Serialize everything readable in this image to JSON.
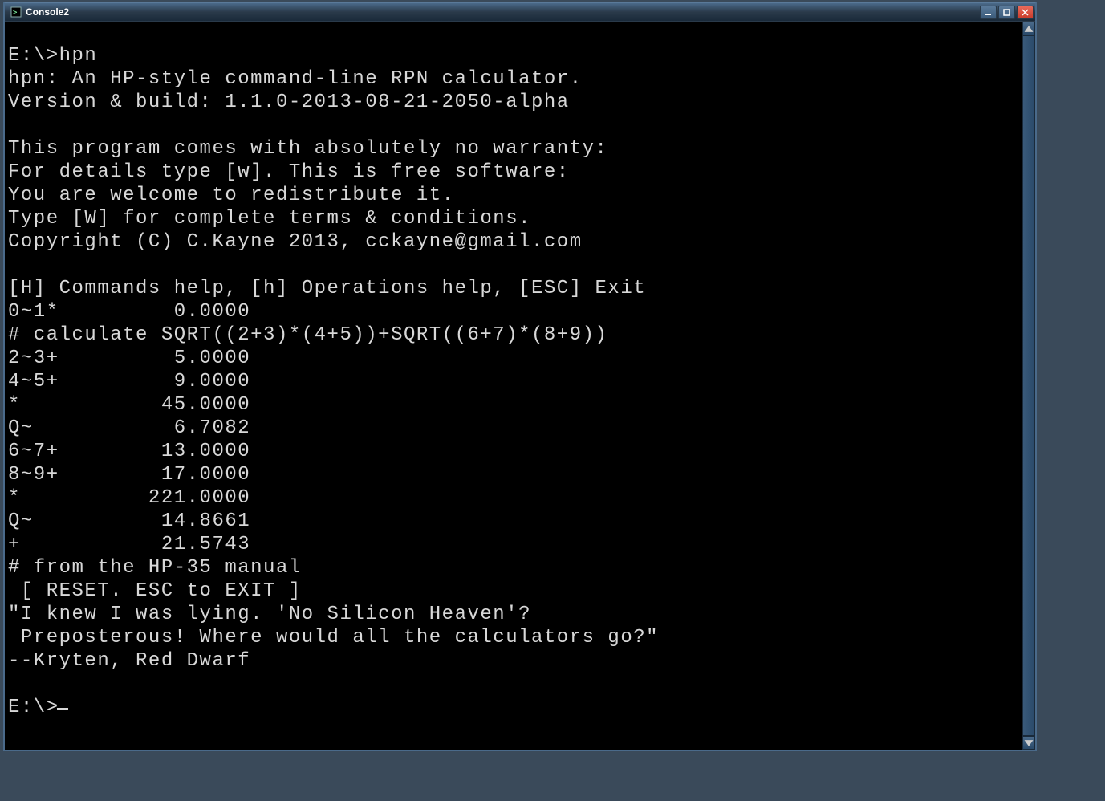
{
  "window": {
    "title": "Console2"
  },
  "terminal": {
    "lines": [
      "E:\\>hpn",
      "hpn: An HP-style command-line RPN calculator.",
      "Version & build: 1.1.0-2013-08-21-2050-alpha",
      "",
      "This program comes with absolutely no warranty:",
      "For details type [w]. This is free software:",
      "You are welcome to redistribute it.",
      "Type [W] for complete terms & conditions.",
      "Copyright (C) C.Kayne 2013, cckayne@gmail.com",
      "",
      "[H] Commands help, [h] Operations help, [ESC] Exit",
      "0~1*         0.0000",
      "# calculate SQRT((2+3)*(4+5))+SQRT((6+7)*(8+9))",
      "2~3+         5.0000",
      "4~5+         9.0000",
      "*           45.0000",
      "Q~           6.7082",
      "6~7+        13.0000",
      "8~9+        17.0000",
      "*          221.0000",
      "Q~          14.8661",
      "+           21.5743",
      "# from the HP-35 manual",
      " [ RESET. ESC to EXIT ]",
      "\"I knew I was lying. 'No Silicon Heaven'?",
      " Preposterous! Where would all the calculators go?\"",
      "--Kryten, Red Dwarf",
      ""
    ],
    "prompt": "E:\\>"
  }
}
